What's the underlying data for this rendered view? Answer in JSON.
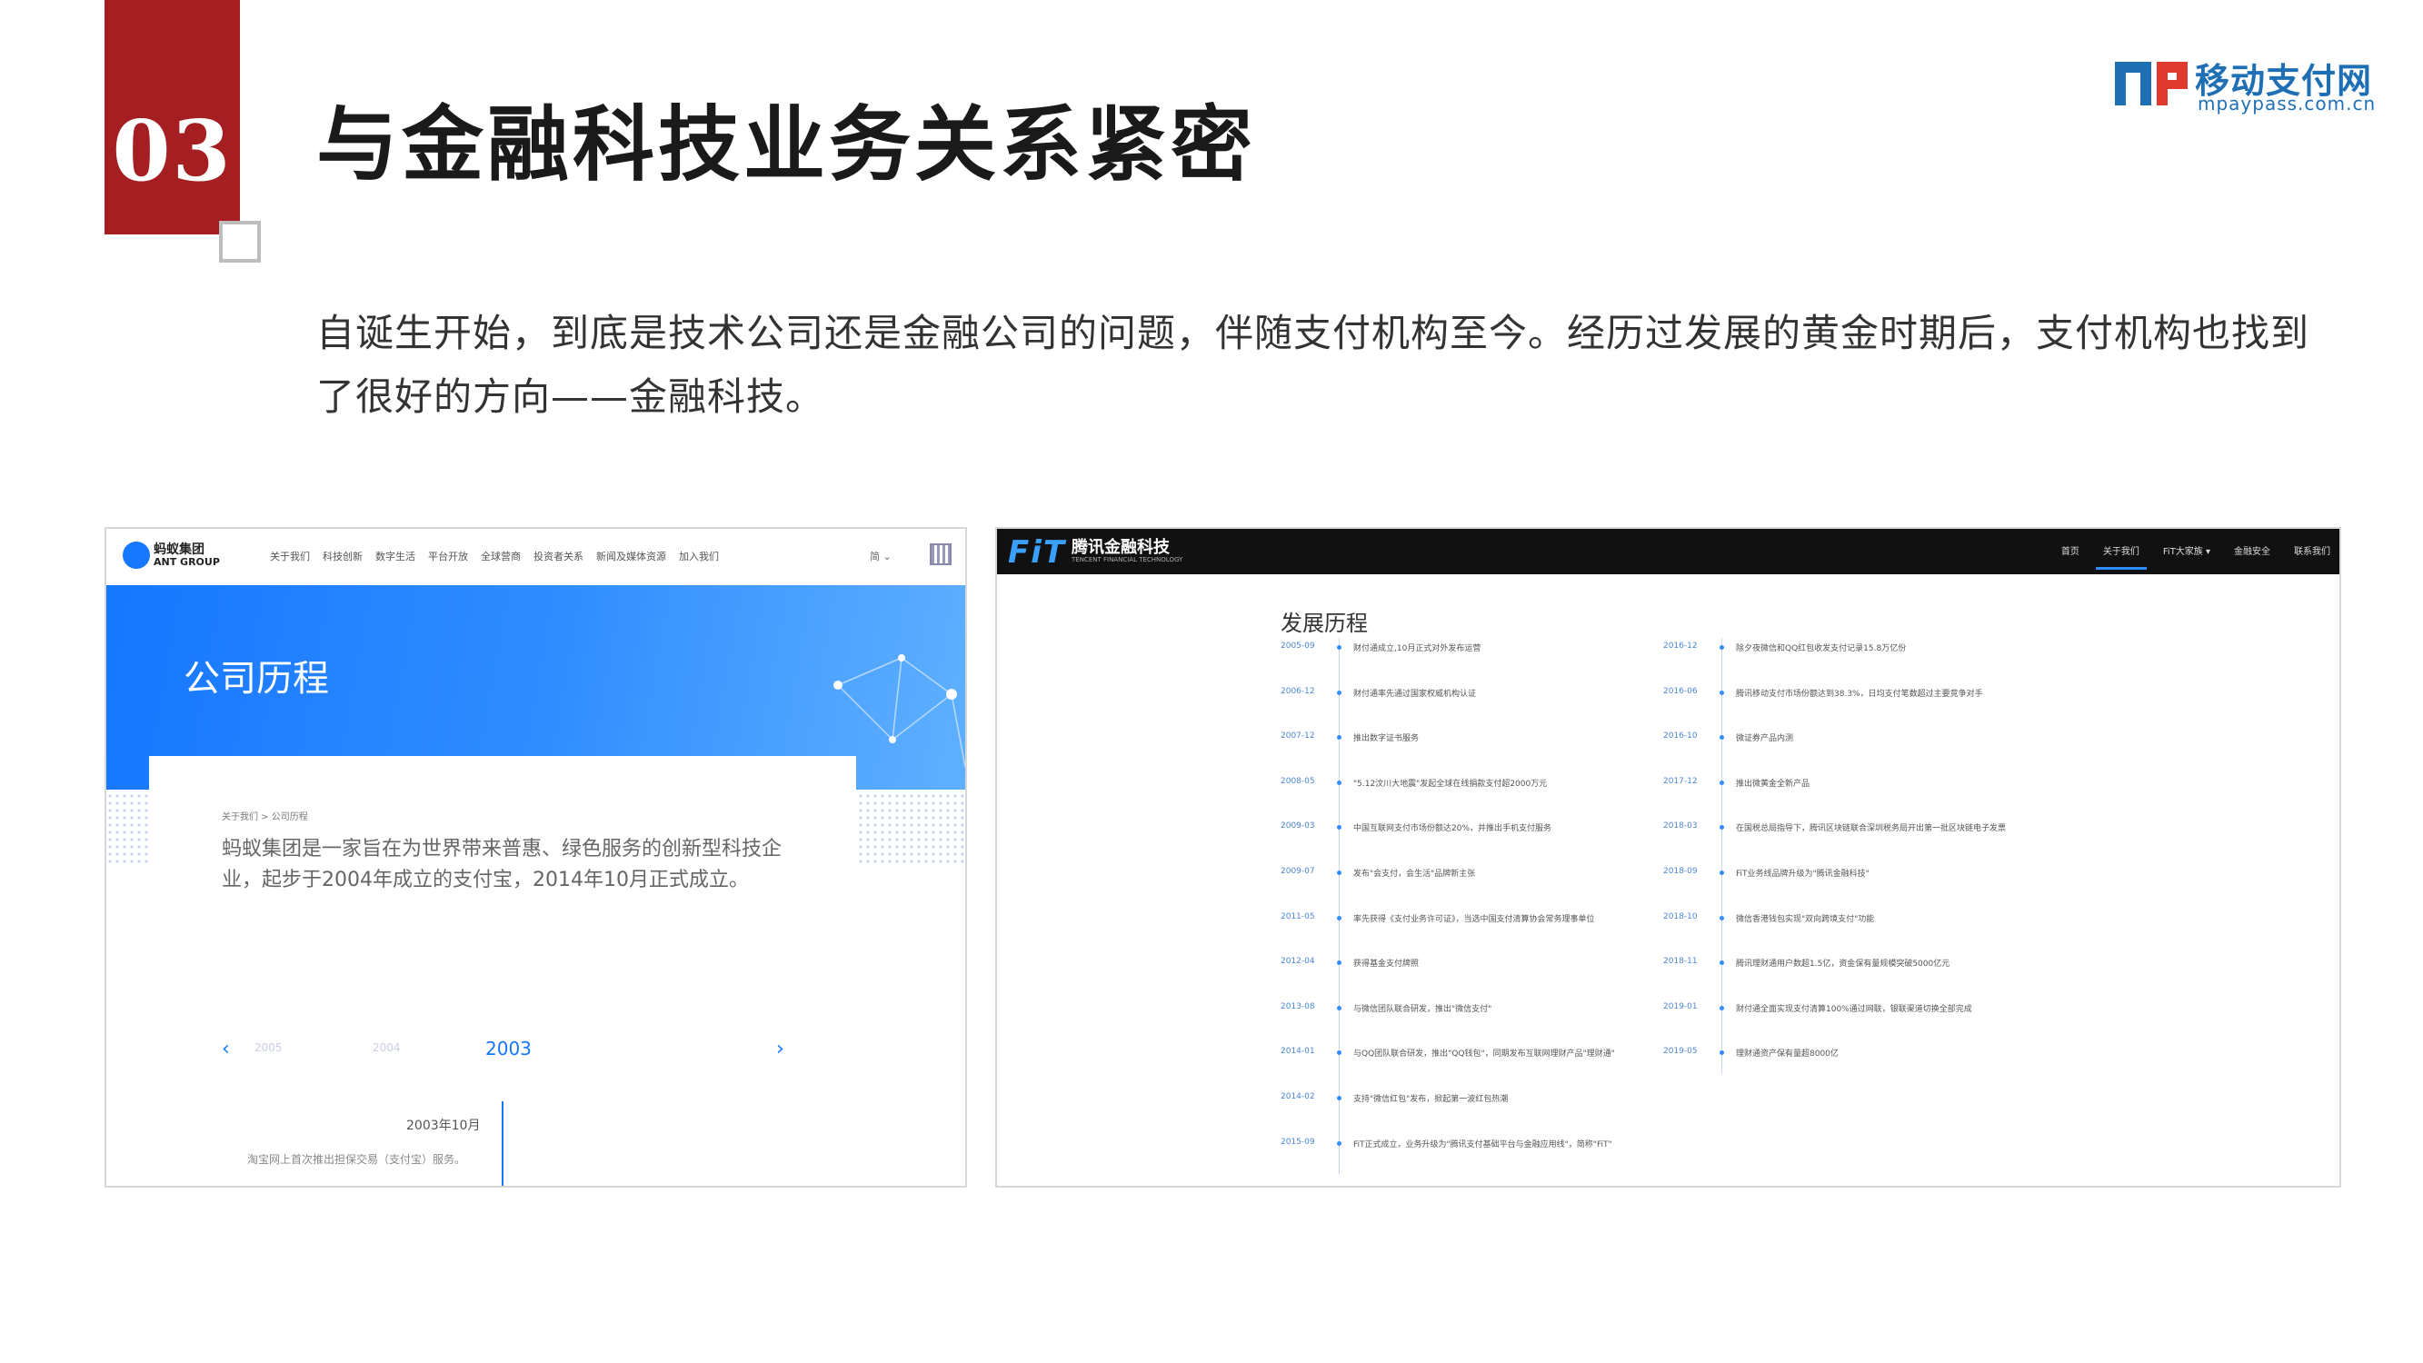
{
  "section": {
    "number": "03",
    "title": "与金融科技业务关系紧密"
  },
  "logo": {
    "name": "移动支付网",
    "domain": "mpaypass.com.cn",
    "color": "#1f6fb5"
  },
  "description": "自诞生开始，到底是技术公司还是金融公司的问题，伴随支付机构至今。经历过发展的黄金时期后，支付机构也找到了很好的方向——金融科技。",
  "ant": {
    "logo_cn": "蚂蚁集团",
    "logo_en": "ANT GROUP",
    "nav": [
      "关于我们",
      "科技创新",
      "数字生活",
      "平台开放",
      "全球营商",
      "投资者关系",
      "新闻及媒体资源",
      "加入我们"
    ],
    "lang": "简",
    "banner_title": "公司历程",
    "breadcrumb": "关于我们  >  公司历程",
    "intro": "蚂蚁集团是一家旨在为世界带来普惠、绿色服务的创新型科技企业，起步于2004年成立的支付宝，2014年10月正式成立。",
    "years": [
      "2005",
      "2004",
      "2003"
    ],
    "prev": "‹",
    "next": "›",
    "event_date": "2003年10月",
    "event_text": "淘宝网上首次推出担保交易（支付宝）服务。",
    "accent": "#1677ff"
  },
  "fit": {
    "logo": "FiT",
    "logo_cn": "腾讯金融科技",
    "logo_en": "TENCENT FINANCIAL TECHNOLOGY",
    "nav": [
      "首页",
      "关于我们",
      "FiT大家族 ▾",
      "金融安全",
      "联系我们"
    ],
    "active_nav": "关于我们",
    "heading": "发展历程",
    "timeline_left": [
      {
        "date": "2005-09",
        "text": "财付通成立,10月正式对外发布运营"
      },
      {
        "date": "2006-12",
        "text": "财付通率先通过国家权威机构认证"
      },
      {
        "date": "2007-12",
        "text": "推出数字证书服务"
      },
      {
        "date": "2008-05",
        "text": "\"5.12汶川大地震\"发起全球在线捐款支付超2000万元"
      },
      {
        "date": "2009-03",
        "text": "中国互联网支付市场份额达20%，并推出手机支付服务"
      },
      {
        "date": "2009-07",
        "text": "发布\"会支付，会生活\"品牌新主张"
      },
      {
        "date": "2011-05",
        "text": "率先获得《支付业务许可证》，当选中国支付清算协会常务理事单位"
      },
      {
        "date": "2012-04",
        "text": "获得基金支付牌照"
      },
      {
        "date": "2013-08",
        "text": "与微信团队联合研发，推出\"微信支付\""
      },
      {
        "date": "2014-01",
        "text": "与QQ团队联合研发，推出\"QQ钱包\"，同期发布互联网理财产品\"理财通\""
      },
      {
        "date": "2014-02",
        "text": "支持\"微信红包\"发布，掀起第一波红包热潮"
      },
      {
        "date": "2015-09",
        "text": "FiT正式成立，业务升级为\"腾讯支付基础平台与金融应用线\"，简称\"FiT\""
      }
    ],
    "timeline_right": [
      {
        "date": "2016-12",
        "text": "除夕夜微信和QQ红包收发支付记录15.8万亿份"
      },
      {
        "date": "2016-06",
        "text": "腾讯移动支付市场份额达到38.3%，日均支付笔数超过主要竞争对手"
      },
      {
        "date": "2016-10",
        "text": "微证券产品内测"
      },
      {
        "date": "2017-12",
        "text": "推出微黄金全新产品"
      },
      {
        "date": "2018-03",
        "text": "在国税总局指导下，腾讯区块链联合深圳税务局开出第一批区块链电子发票"
      },
      {
        "date": "2018-09",
        "text": "FiT业务线品牌升级为\"腾讯金融科技\""
      },
      {
        "date": "2018-10",
        "text": "微信香港钱包实现\"双向跨境支付\"功能"
      },
      {
        "date": "2018-11",
        "text": "腾讯理财通用户数超1.5亿，资金保有量规模突破5000亿元"
      },
      {
        "date": "2019-01",
        "text": "财付通全面实现支付清算100%通过网联，银联渠道切换全部完成"
      },
      {
        "date": "2019-05",
        "text": "理财通资产保有量超8000亿"
      }
    ]
  }
}
